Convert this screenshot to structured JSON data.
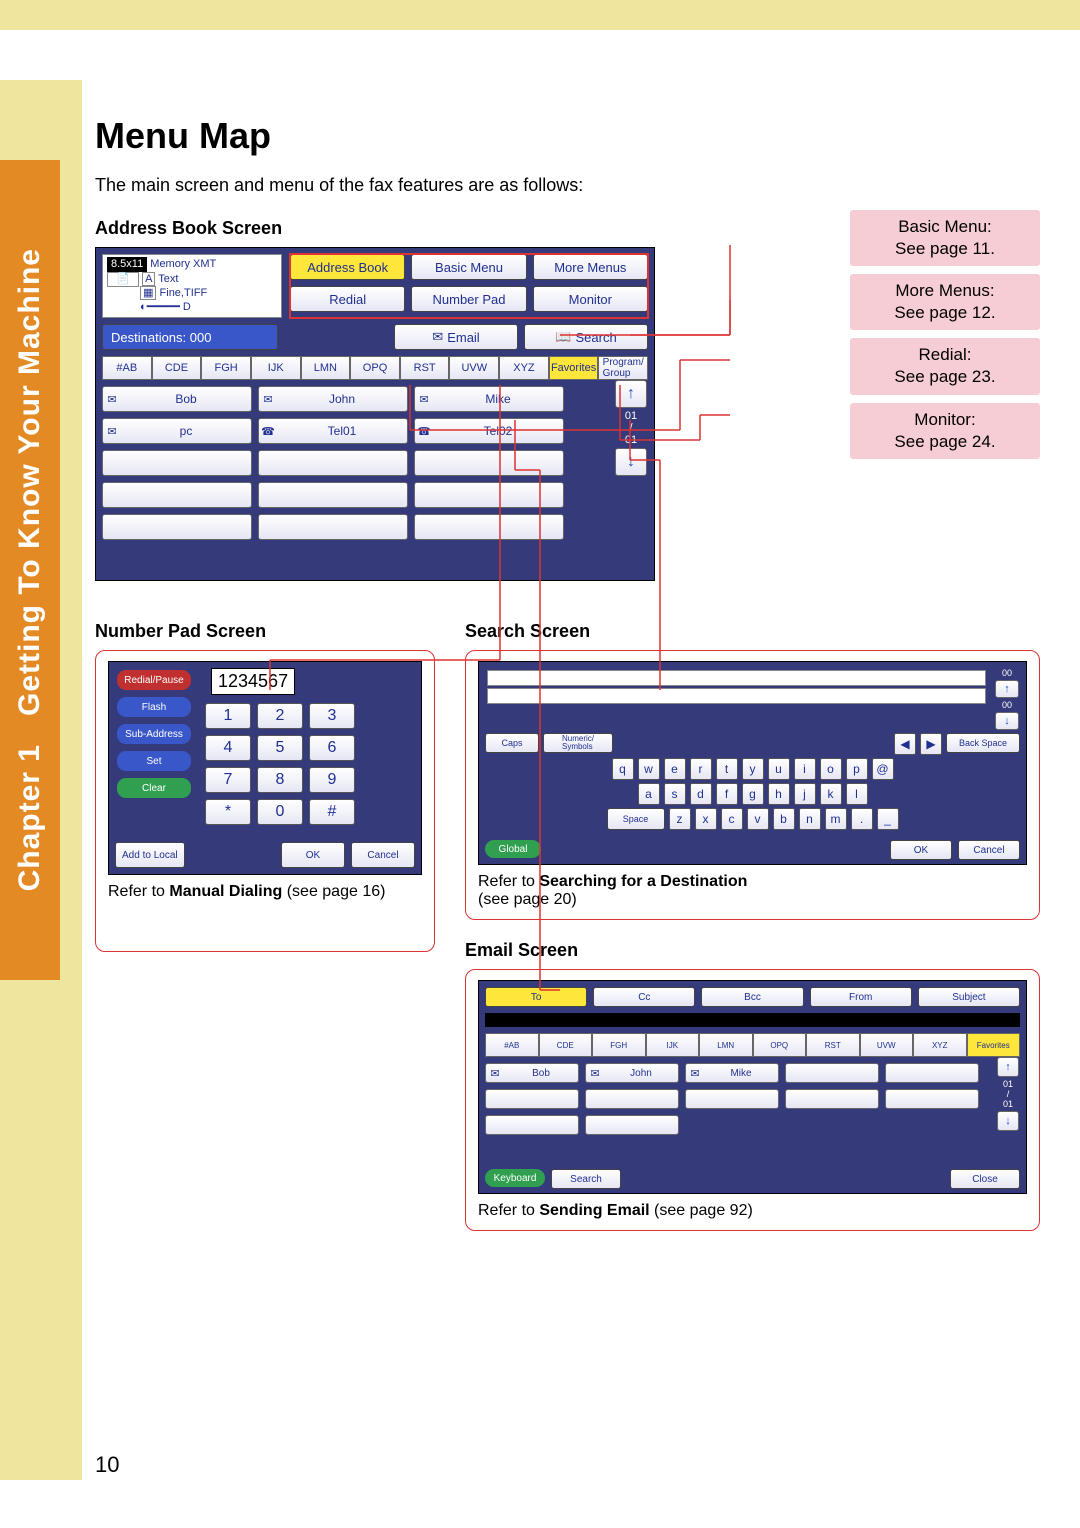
{
  "sidebar": {
    "chapter": "Chapter 1",
    "title": "Getting To Know Your Machine"
  },
  "heading": "Menu Map",
  "intro": "The main screen and menu of the fax features are as follows:",
  "refs": {
    "basic": "Basic Menu:\nSee page 11.",
    "more": "More Menus:\nSee page 12.",
    "redial": "Redial:\nSee page 23.",
    "monitor": "Monitor:\nSee page 24."
  },
  "address_book": {
    "label": "Address Book Screen",
    "status": {
      "size": "8.5x11",
      "mode": "Memory XMT",
      "quality": "Text",
      "res": "Fine,TIFF",
      "contrast_id": "D",
      "a_icon": "A"
    },
    "buttons": {
      "addr": "Address Book",
      "basic": "Basic Menu",
      "more": "More Menus",
      "redial": "Redial",
      "numpad": "Number Pad",
      "monitor": "Monitor",
      "email": "Email",
      "search": "Search"
    },
    "dest": "Destinations: 000",
    "tabs": [
      "#AB",
      "CDE",
      "FGH",
      "IJK",
      "LMN",
      "OPQ",
      "RST",
      "UVW",
      "XYZ",
      "Favorites",
      "Program/\nGroup"
    ],
    "entries": [
      {
        "icon": "mail",
        "name": "Bob"
      },
      {
        "icon": "mail",
        "name": "John"
      },
      {
        "icon": "mail",
        "name": "Mike"
      },
      {
        "icon": "mail",
        "name": "pc"
      },
      {
        "icon": "phone",
        "name": "Tel01"
      },
      {
        "icon": "phone",
        "name": "Tel02"
      }
    ],
    "scroll": {
      "pos": "01",
      "sep": "/",
      "total": "01"
    }
  },
  "number_pad": {
    "label": "Number Pad Screen",
    "display": "1234567",
    "side": [
      "Redial/Pause",
      "Flash",
      "Sub-Address",
      "Set",
      "Clear"
    ],
    "add": "Add to Local",
    "keys": [
      "1",
      "2",
      "3",
      "4",
      "5",
      "6",
      "7",
      "8",
      "9",
      "*",
      "0",
      "#"
    ],
    "ok": "OK",
    "cancel": "Cancel",
    "caption_pre": "Refer to ",
    "caption_b": "Manual Dialing",
    "caption_post": " (see page 16)"
  },
  "search": {
    "label": "Search Screen",
    "caps": "Caps",
    "numsym": "Numeric/\nSymbols",
    "back": "Back Space",
    "space": "Space",
    "global": "Global",
    "ok": "OK",
    "cancel": "Cancel",
    "row1": [
      "q",
      "w",
      "e",
      "r",
      "t",
      "y",
      "u",
      "i",
      "o",
      "p",
      "@"
    ],
    "row2": [
      "a",
      "s",
      "d",
      "f",
      "g",
      "h",
      "j",
      "k",
      "l"
    ],
    "row3": [
      "z",
      "x",
      "c",
      "v",
      "b",
      "n",
      "m",
      ".",
      "_"
    ],
    "scroll": {
      "pos": "00",
      "sep": "/",
      "total": "00"
    },
    "caption_pre": "Refer to ",
    "caption_b": "Searching for a Destination",
    "caption_post": "\n(see page 20)"
  },
  "email": {
    "label": "Email Screen",
    "top": [
      "To",
      "Cc",
      "Bcc",
      "From",
      "Subject"
    ],
    "tabs": [
      "#AB",
      "CDE",
      "FGH",
      "IJK",
      "LMN",
      "OPQ",
      "RST",
      "UVW",
      "XYZ",
      "Favorites"
    ],
    "entries": [
      {
        "icon": "mail",
        "name": "Bob"
      },
      {
        "icon": "mail",
        "name": "John"
      },
      {
        "icon": "mail",
        "name": "Mike"
      }
    ],
    "bottom": {
      "kb": "Keyboard",
      "search": "Search",
      "close": "Close"
    },
    "scroll": {
      "pos": "01",
      "sep": "/",
      "total": "01"
    },
    "caption_pre": "Refer to ",
    "caption_b": "Sending Email",
    "caption_post": " (see page 92)"
  },
  "page_number": "10"
}
